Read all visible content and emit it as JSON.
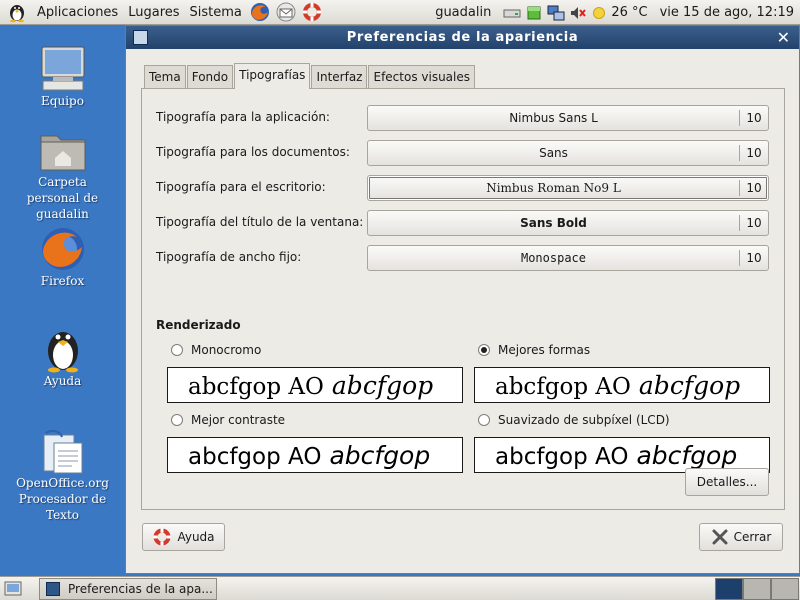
{
  "top_panel": {
    "menus": [
      "Aplicaciones",
      "Lugares",
      "Sistema"
    ],
    "user": "guadalin",
    "temperature": "26 °C",
    "clock": "vie 15 de ago, 12:19"
  },
  "desktop": {
    "icons": [
      "Equipo",
      "Carpeta personal de guadalin",
      "Firefox",
      "Ayuda",
      "OpenOffice.org Procesador de Texto"
    ]
  },
  "window": {
    "title": "Preferencias de la apariencia",
    "tabs": [
      "Tema",
      "Fondo",
      "Tipografías",
      "Interfaz",
      "Efectos visuales"
    ],
    "active_tab": "Tipografías",
    "font_rows": [
      {
        "label": "Tipografía para la aplicación:",
        "font": "Nimbus Sans L",
        "size": "10"
      },
      {
        "label": "Tipografía para los documentos:",
        "font": "Sans",
        "size": "10"
      },
      {
        "label": "Tipografía para el escritorio:",
        "font": "Nimbus Roman No9 L",
        "size": "10"
      },
      {
        "label": "Tipografía del título de la ventana:",
        "font": "Sans Bold",
        "size": "10"
      },
      {
        "label": "Tipografía de ancho fijo:",
        "font": "Monospace",
        "size": "10"
      }
    ],
    "rendering": {
      "title": "Renderizado",
      "options": [
        {
          "label": "Monocromo",
          "checked": false
        },
        {
          "label": "Mejores formas",
          "checked": true
        },
        {
          "label": "Mejor contraste",
          "checked": false
        },
        {
          "label": "Suavizado de subpíxel (LCD)",
          "checked": false
        }
      ],
      "sample_roman": "abcfgop AO",
      "sample_italic": "abcfgop"
    },
    "details_label": "Detalles...",
    "help_label": "Ayuda",
    "close_label": "Cerrar"
  },
  "taskbar": {
    "window_label": "Preferencias de la apa..."
  },
  "colors": {
    "desktop": "#3a78c4",
    "titlebar": "#22426b",
    "window_bg": "#edebe6"
  }
}
